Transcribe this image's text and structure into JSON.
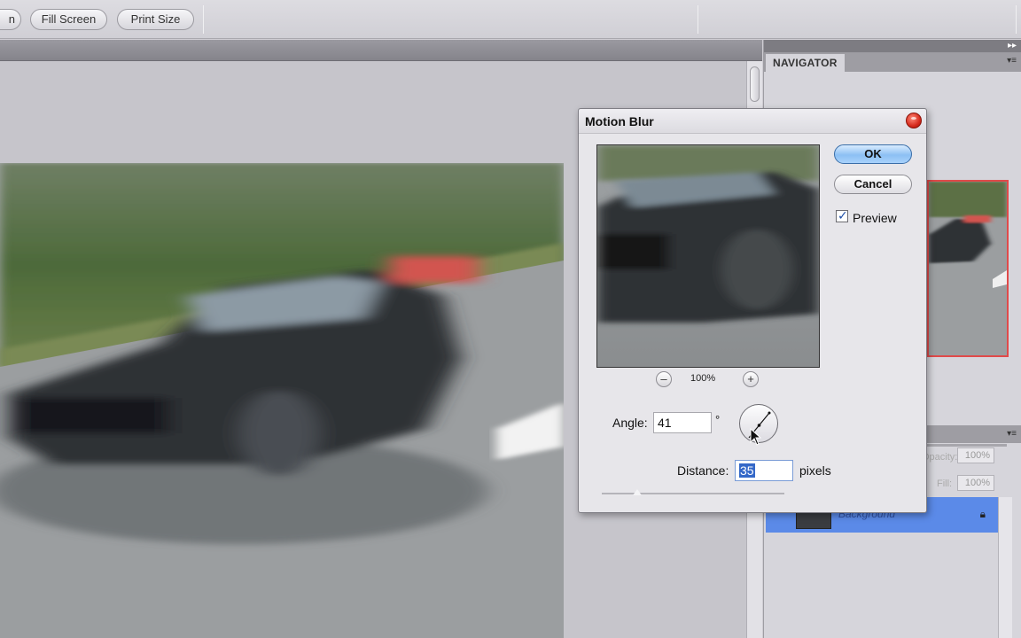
{
  "options_bar": {
    "partial_button_label": "n",
    "fill_screen_label": "Fill Screen",
    "print_size_label": "Print Size"
  },
  "navigator": {
    "tab_label": "NAVIGATOR"
  },
  "layers": {
    "opacity_label": "Opacity:",
    "opacity_value": "100%",
    "fill_label": "Fill:",
    "fill_value": "100%",
    "layer_name": "Background"
  },
  "dialog": {
    "title": "Motion Blur",
    "ok_label": "OK",
    "cancel_label": "Cancel",
    "preview_label": "Preview",
    "preview_checked": true,
    "zoom_minus": "–",
    "zoom_plus": "+",
    "zoom_value": "100%",
    "angle_label": "Angle:",
    "angle_value": "41",
    "degree_symbol": "°",
    "distance_label": "Distance:",
    "distance_value": "35",
    "pixels_label": "pixels"
  },
  "colors": {
    "selection_blue": "#3468c8",
    "layer_highlight": "#5b8ae8",
    "navigator_frame": "#e04a4a"
  }
}
